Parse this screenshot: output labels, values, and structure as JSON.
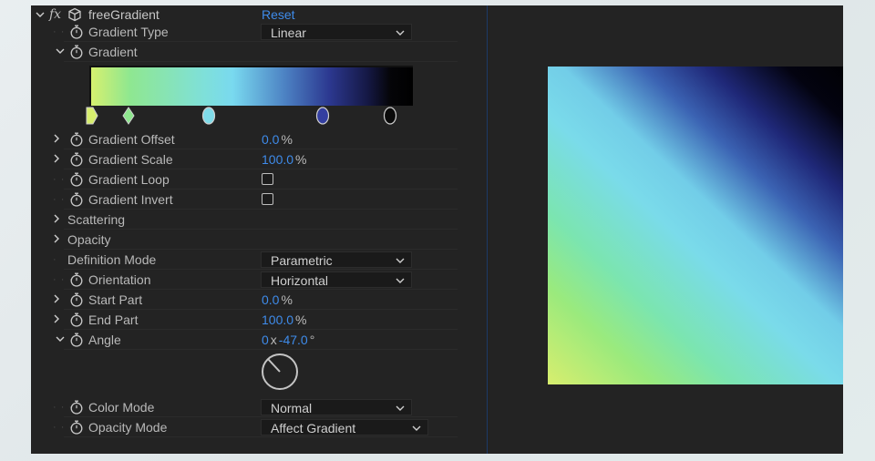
{
  "effect": {
    "title": "freeGradient",
    "reset_label": "Reset",
    "fx_icon": "fx"
  },
  "gradient_type": {
    "label": "Gradient Type",
    "value": "Linear"
  },
  "gradient": {
    "label": "Gradient",
    "stops": [
      {
        "position": 0.0,
        "color": "#d7ee6e"
      },
      {
        "position": 0.12,
        "color": "#8ee78e"
      },
      {
        "position": 0.37,
        "color": "#7fdbe9"
      },
      {
        "position": 0.72,
        "color": "#343fa0"
      },
      {
        "position": 0.93,
        "color": "#0a0a0a"
      }
    ]
  },
  "gradient_offset": {
    "label": "Gradient Offset",
    "value": "0.0",
    "unit": "%"
  },
  "gradient_scale": {
    "label": "Gradient Scale",
    "value": "100.0",
    "unit": "%"
  },
  "gradient_loop": {
    "label": "Gradient Loop",
    "checked": false
  },
  "gradient_invert": {
    "label": "Gradient Invert",
    "checked": false
  },
  "scattering": {
    "label": "Scattering"
  },
  "opacity": {
    "label": "Opacity"
  },
  "definition_mode": {
    "label": "Definition Mode",
    "value": "Parametric"
  },
  "orientation": {
    "label": "Orientation",
    "value": "Horizontal"
  },
  "start_part": {
    "label": "Start Part",
    "value": "0.0",
    "unit": "%"
  },
  "end_part": {
    "label": "End Part",
    "value": "100.0",
    "unit": "%"
  },
  "angle": {
    "label": "Angle",
    "revolutions": "0",
    "separator": "x",
    "degrees": "-47.0",
    "unit": "°"
  },
  "color_mode": {
    "label": "Color Mode",
    "value": "Normal"
  },
  "opacity_mode": {
    "label": "Opacity Mode",
    "value": "Affect Gradient"
  },
  "colors": {
    "accent": "#3e8bea",
    "panel_bg": "#232323",
    "separator": "#1c3a66"
  },
  "icons": [
    "twirl-down-icon",
    "twirl-right-icon",
    "stopwatch-icon",
    "chevron-down-icon",
    "fx-icon",
    "cube-icon",
    "angle-dial-icon"
  ]
}
